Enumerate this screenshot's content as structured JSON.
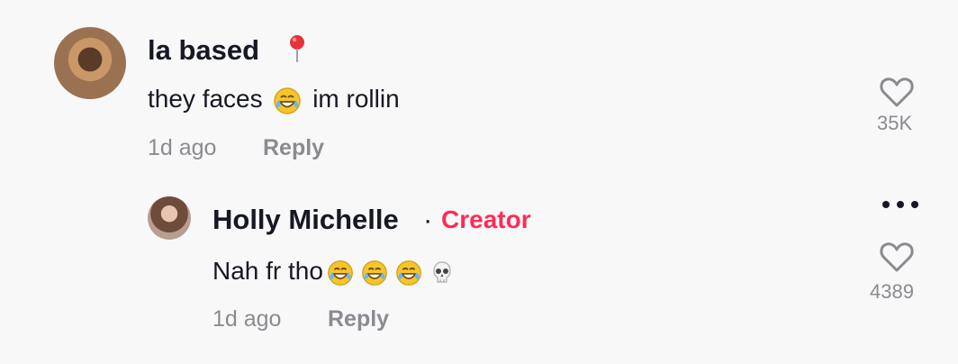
{
  "comment": {
    "username": "la based",
    "text_before": "they faces",
    "text_after": "im rollin",
    "time": "1d ago",
    "reply_label": "Reply",
    "likes": "35K",
    "icons": [
      "avatar",
      "pin-icon",
      "laughing-emoji-icon",
      "heart-icon"
    ]
  },
  "reply": {
    "username": "Holly Michelle",
    "separator": "·",
    "badge": "Creator",
    "text": "Nah fr tho",
    "time": "1d ago",
    "reply_label": "Reply",
    "likes": "4389",
    "icons": [
      "avatar",
      "laughing-emoji-icon",
      "skull-emoji-icon",
      "heart-icon",
      "more-icon"
    ]
  },
  "colors": {
    "text": "#161823",
    "muted": "#8a8b91",
    "creator": "#fe2c55",
    "background": "#f8f8f8"
  }
}
